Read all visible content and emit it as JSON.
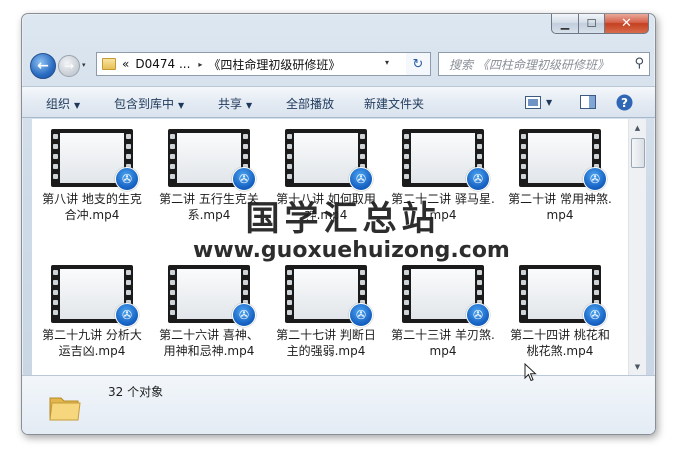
{
  "window": {
    "caption_icons": [
      "minimize-icon",
      "maximize-icon",
      "close-icon"
    ]
  },
  "nav": {
    "recent_arrow": "▾",
    "address_overflow": "«",
    "address_segments": [
      "D0474 ...",
      "《四柱命理初级研修班》"
    ],
    "address_sep": "▸",
    "search_placeholder": "搜索 《四柱命理初级研修班》"
  },
  "toolbar": {
    "organize": "组织",
    "include_library": "包含到库中",
    "share": "共享",
    "play_all": "全部播放",
    "new_folder": "新建文件夹"
  },
  "files": [
    {
      "name": "第八讲  地支的生克合冲.mp4"
    },
    {
      "name": "第二讲  五行生克关系.mp4"
    },
    {
      "name": "第十八讲  如何取用神.mp4"
    },
    {
      "name": "第二十二讲  驿马星.mp4"
    },
    {
      "name": "第二十讲  常用神煞.mp4"
    },
    {
      "name": "第二十九讲  分析大运吉凶.mp4"
    },
    {
      "name": "第二十六讲  喜神、用神和忌神.mp4"
    },
    {
      "name": "第二十七讲  判断日主的强弱.mp4"
    },
    {
      "name": "第二十三讲  羊刃煞.mp4"
    },
    {
      "name": "第二十四讲  桃花和桃花煞.mp4"
    }
  ],
  "details": {
    "count": "32 个对象"
  },
  "watermark": {
    "cn": "国学汇总站",
    "url": "www.guoxuehuizong.com"
  },
  "colors": {
    "accent": "#1662c4",
    "toolbar_text": "#1e395b",
    "close_button": "#c4401f"
  }
}
